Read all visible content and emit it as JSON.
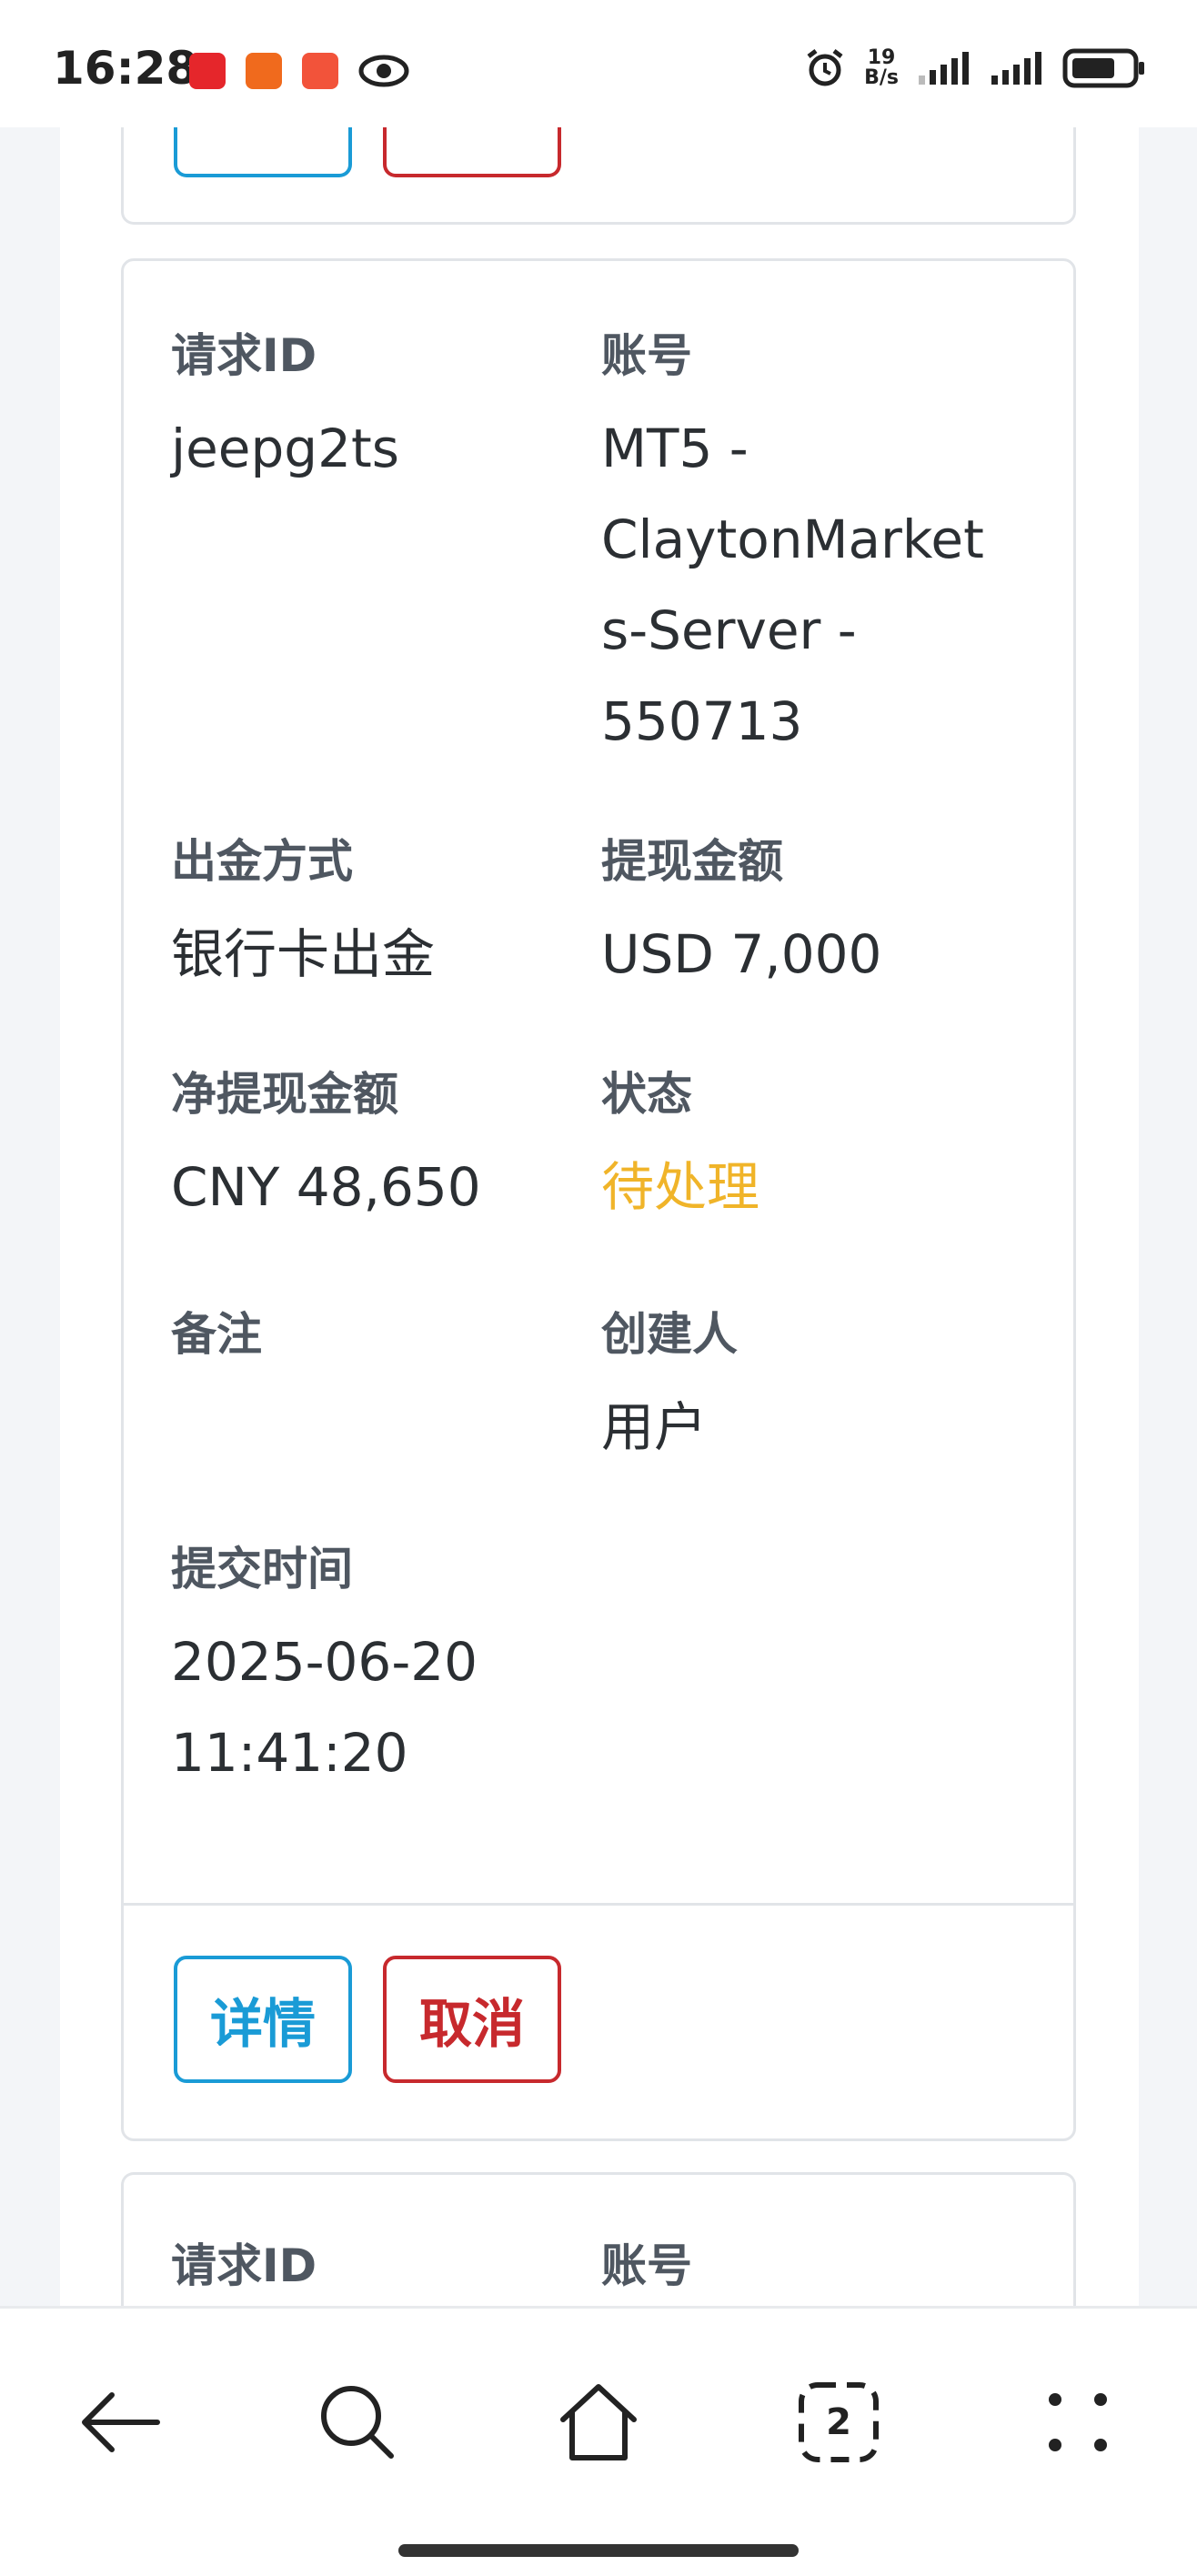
{
  "status_bar": {
    "time": "16:28",
    "net_speed_value": "19",
    "net_speed_unit": "B/s",
    "icons": [
      "app-red-icon",
      "app-orange-icon",
      "app-orange-red-icon",
      "eye-icon",
      "alarm-icon",
      "signal-icon",
      "signal-icon",
      "battery-icon"
    ]
  },
  "request": {
    "id_label": "请求ID",
    "id_value": "jeepg2ts",
    "account_label": "账号",
    "account_value_lines": [
      "MT5 -",
      "ClaytonMarket",
      "s-Server -",
      "550713"
    ],
    "method_label": "出金方式",
    "method_value": "银行卡出金",
    "amount_label": "提现金额",
    "amount_value": "USD 7,000",
    "net_amount_label": "净提现金额",
    "net_amount_value": "CNY 48,650",
    "status_label": "状态",
    "status_value": "待处理",
    "remark_label": "备注",
    "remark_value": "",
    "creator_label": "创建人",
    "creator_value": "用户",
    "submit_time_label": "提交时间",
    "submit_time_lines": [
      "2025-06-20",
      "11:41:20"
    ],
    "detail_button": "详情",
    "cancel_button": "取消"
  },
  "next_request": {
    "id_label": "请求ID",
    "account_label": "账号"
  },
  "nav": {
    "tab_count": "2"
  },
  "colors": {
    "primary": "#1a9bd6",
    "danger": "#c7292d",
    "pending": "#f0b429"
  }
}
